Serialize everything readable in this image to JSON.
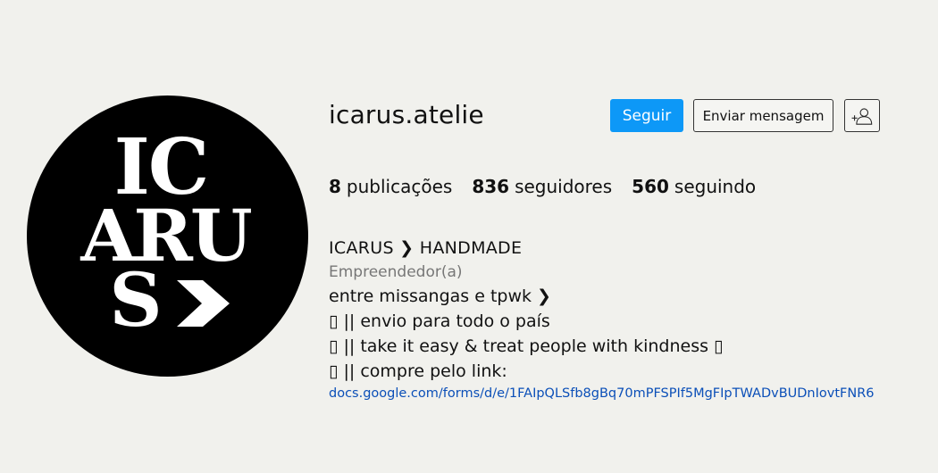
{
  "profile": {
    "avatar_text": "ICARUS",
    "username": "icarus.atelie"
  },
  "actions": {
    "follow_label": "Seguir",
    "message_label": "Enviar mensagem",
    "add_user_icon": "add-user-icon"
  },
  "stats": {
    "posts_count": "8",
    "posts_label": "publicações",
    "followers_count": "836",
    "followers_label": "seguidores",
    "following_count": "560",
    "following_label": "seguindo"
  },
  "bio": {
    "name": "ICARUS ❯ HANDMADE",
    "category": "Empreendedor(a)",
    "lines": [
      "entre missangas e tpwk ❯",
      "▯ || envio para todo o país",
      "▯ || take it easy & treat people with kindness ▯",
      "▯ || compre pelo link:"
    ],
    "link": "docs.google.com/forms/d/e/1FAIpQLSfb8gBq70mPFSPIf5MgFIpTWADvBUDnIovtFNR6"
  },
  "colors": {
    "background": "#f1f1ed",
    "follow_button": "#0d98f7",
    "link": "#0b4fb8"
  }
}
